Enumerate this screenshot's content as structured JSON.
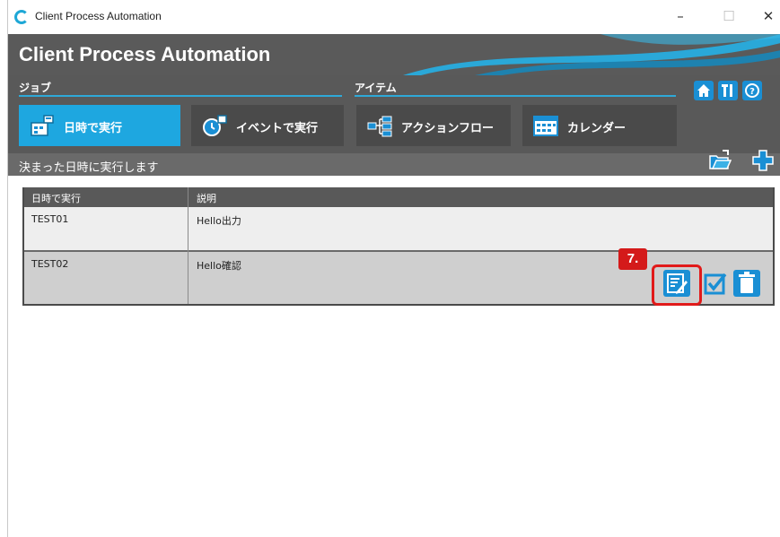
{
  "window": {
    "title": "Client Process Automation",
    "minimize": "–",
    "maximize": "☐",
    "close": "✕"
  },
  "header": {
    "banner_title": "Client Process Automation",
    "section_job": "ジョブ",
    "section_item": "アイテム",
    "status_text": "決まった日時に実行します"
  },
  "tabs": [
    {
      "label": "日時で実行",
      "icon": "calendar-grid-icon",
      "active": true
    },
    {
      "label": "イベントで実行",
      "icon": "event-clock-icon",
      "active": false
    },
    {
      "label": "アクションフロー",
      "icon": "flow-icon",
      "active": false
    },
    {
      "label": "カレンダー",
      "icon": "calendar-icon",
      "active": false
    }
  ],
  "top_icons": [
    "home-icon",
    "tools-icon",
    "help-icon"
  ],
  "action_icons": [
    "open-folder-icon",
    "add-icon"
  ],
  "table": {
    "headers": [
      "日時で実行",
      "説明"
    ],
    "rows": [
      {
        "name": "TEST01",
        "description": "Hello出力"
      },
      {
        "name": "TEST02",
        "description": "Hello確認"
      }
    ]
  },
  "row_actions": [
    "edit-icon",
    "check-icon",
    "delete-icon"
  ],
  "callout": "7.",
  "colors": {
    "accent": "#1ea7e0",
    "header_bg": "#595959",
    "highlight": "#e11a1a"
  }
}
